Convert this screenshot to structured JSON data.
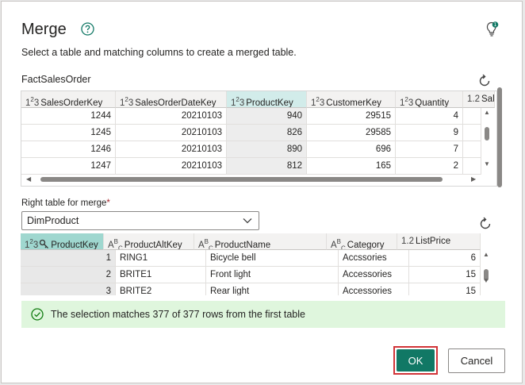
{
  "dialog": {
    "title": "Merge",
    "subtitle": "Select a table and matching columns to create a merged table.",
    "help_icon": "help-circle-icon",
    "bulb_icon": "lightbulb-icon"
  },
  "left_table": {
    "name": "FactSalesOrder",
    "columns": [
      {
        "type": "123",
        "name": "SalesOrderKey"
      },
      {
        "type": "123",
        "name": "SalesOrderDateKey"
      },
      {
        "type": "123",
        "name": "ProductKey"
      },
      {
        "type": "123",
        "name": "CustomerKey"
      },
      {
        "type": "123",
        "name": "Quantity"
      },
      {
        "type": "1.2",
        "name": "Sal"
      }
    ],
    "rows": [
      [
        "1244",
        "20210103",
        "940",
        "29515",
        "4",
        ""
      ],
      [
        "1245",
        "20210103",
        "826",
        "29585",
        "9",
        ""
      ],
      [
        "1246",
        "20210103",
        "890",
        "696",
        "7",
        ""
      ],
      [
        "1247",
        "20210103",
        "812",
        "165",
        "2",
        ""
      ]
    ],
    "selected_column": "ProductKey"
  },
  "right_table": {
    "label": "Right table for merge",
    "required_mark": "*",
    "selected": "DimProduct",
    "columns": [
      {
        "type": "123",
        "name": "ProductKey",
        "key": true
      },
      {
        "type": "ABC",
        "name": "ProductAltKey"
      },
      {
        "type": "ABC",
        "name": "ProductName"
      },
      {
        "type": "ABC",
        "name": "Category"
      },
      {
        "type": "1.2",
        "name": "ListPrice"
      }
    ],
    "rows": [
      [
        "1",
        "RING1",
        "Bicycle bell",
        "Accssories",
        "6"
      ],
      [
        "2",
        "BRITE1",
        "Front light",
        "Accessories",
        "15"
      ],
      [
        "3",
        "BRITE2",
        "Rear light",
        "Accessories",
        "15"
      ]
    ]
  },
  "status": {
    "message": "The selection matches 377 of 377 rows from the first table",
    "icon": "check-circle-icon"
  },
  "buttons": {
    "ok": "OK",
    "cancel": "Cancel"
  },
  "colors": {
    "accent": "#117865",
    "success_bg": "#dff6dd",
    "highlight_border": "#d13438"
  }
}
